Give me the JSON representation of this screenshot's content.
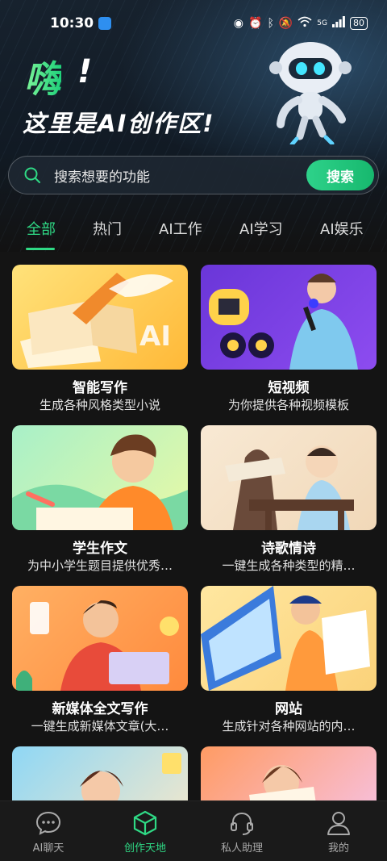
{
  "status_bar": {
    "time": "10:30",
    "battery": "80",
    "network": "5G"
  },
  "hero": {
    "greeting": "嗨",
    "greeting_mark": "!",
    "subtitle": "这里是AI创作区!"
  },
  "search": {
    "placeholder": "搜索想要的功能",
    "button_label": "搜索"
  },
  "tabs": [
    {
      "label": "全部",
      "active": true
    },
    {
      "label": "热门",
      "active": false
    },
    {
      "label": "AI工作",
      "active": false
    },
    {
      "label": "AI学习",
      "active": false
    },
    {
      "label": "AI娱乐",
      "active": false
    }
  ],
  "cards": [
    {
      "title": "智能写作",
      "desc": "生成各种风格类型小说",
      "badge": "AI"
    },
    {
      "title": "短视频",
      "desc": "为你提供各种视频模板"
    },
    {
      "title": "学生作文",
      "desc": "为中小学生题目提供优秀…"
    },
    {
      "title": "诗歌情诗",
      "desc": "一键生成各种类型的精…"
    },
    {
      "title": "新媒体全文写作",
      "desc": "一键生成新媒体文章(大…"
    },
    {
      "title": "网站",
      "desc": "生成针对各种网站的内…"
    },
    {
      "title": "",
      "desc": ""
    },
    {
      "title": "",
      "desc": ""
    }
  ],
  "bottom_nav": [
    {
      "label": "AI聊天",
      "icon": "chat-bubble-icon",
      "active": false
    },
    {
      "label": "创作天地",
      "icon": "cube-icon",
      "active": true
    },
    {
      "label": "私人助理",
      "icon": "headset-icon",
      "active": false
    },
    {
      "label": "我的",
      "icon": "person-icon",
      "active": false
    }
  ],
  "colors": {
    "accent": "#2fd985",
    "background": "#141414"
  }
}
